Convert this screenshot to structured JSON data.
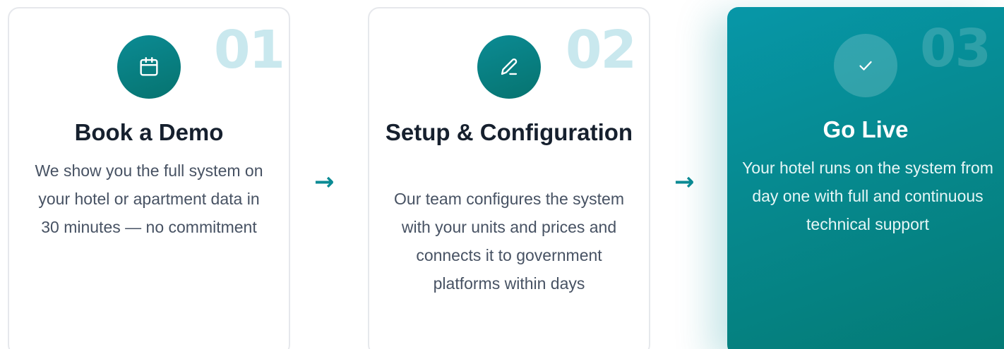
{
  "steps": [
    {
      "number": "01",
      "icon": "calendar-icon",
      "title": "Book a Demo",
      "description": "We show you the full system on your hotel or apartment data in 30 minutes — no commitment"
    },
    {
      "number": "02",
      "icon": "pencil-icon",
      "title": "Setup & Configuration",
      "description": "Our team configures the system with your units and prices and connects it to government platforms within days"
    },
    {
      "number": "03",
      "icon": "check-icon",
      "title": "Go Live",
      "description": "Your hotel runs on the system from day one with full and continuous technical support"
    }
  ],
  "arrows": [
    "→",
    "→"
  ],
  "colors": {
    "accent": "#0b8b94",
    "accent_dark": "#06736f",
    "number_tint": "#c9e8ee",
    "title_text": "#16202e",
    "body_text": "#475263",
    "card_border": "#e6e8ec"
  }
}
